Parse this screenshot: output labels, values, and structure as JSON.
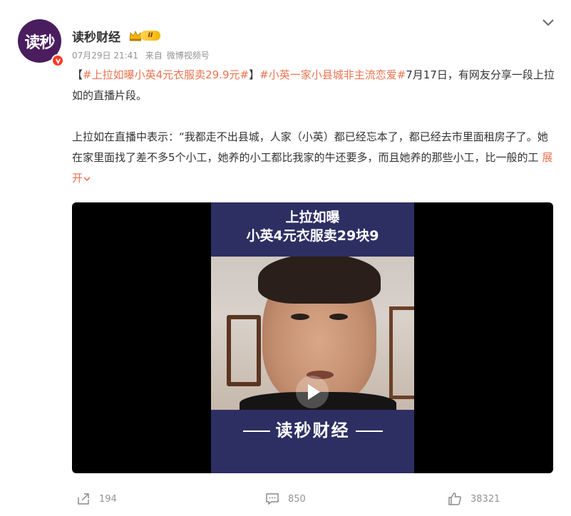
{
  "author": {
    "name": "读秒财经",
    "avatar_text": "读秒",
    "level_badge": "II"
  },
  "meta": {
    "date": "07月29日 21:41",
    "source_prefix": "来自",
    "source": "微博视频号"
  },
  "post": {
    "bracket_open": "【",
    "topic1": "#上拉如曝小英4元衣服卖29.9元#",
    "bracket_close": "】",
    "topic2": "#小英一家小县城非主流恋爱#",
    "text1": "7月17日，有网友分享一段上拉如的直播片段。",
    "text2": "上拉如在直播中表示：“我都走不出县城，人家（小英）都已经忘本了，都已经去市里面租房子了。她在家里面找了差不多5个小工，她养的小工都比我家的牛还要多，而且她养的那些小工，比一般的工",
    "expand_label": "展开"
  },
  "video": {
    "title_line1": "上拉如曝",
    "title_line2": "小英4元衣服卖29块9",
    "brand": "读秒财经"
  },
  "actions": {
    "share_count": "194",
    "comment_count": "850",
    "like_count": "38321"
  },
  "colors": {
    "topic": "#eb7350",
    "avatar_bg": "#4a1d5e",
    "video_bg": "#2d2f63",
    "meta": "#939393"
  }
}
